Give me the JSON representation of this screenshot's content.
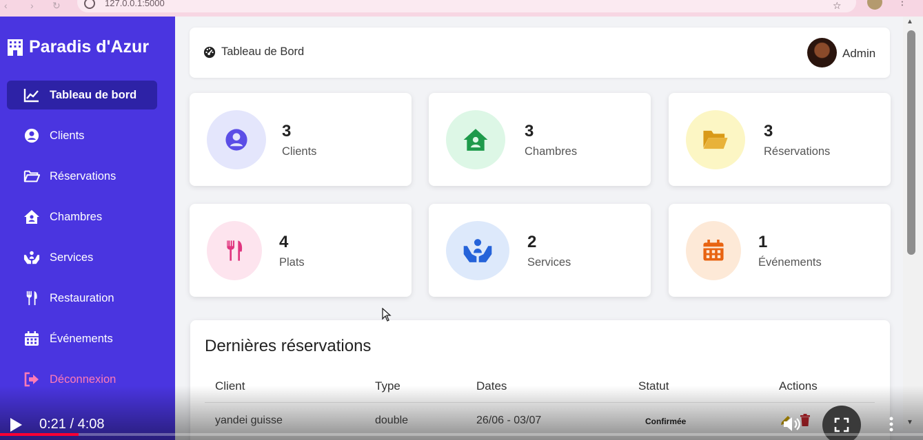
{
  "browser": {
    "url": "127.0.0.1:5000"
  },
  "sidebar": {
    "brand": "Paradis d'Azur",
    "items": [
      {
        "label": "Tableau de bord",
        "icon": "chart-line-icon",
        "active": true
      },
      {
        "label": "Clients",
        "icon": "user-circle-icon"
      },
      {
        "label": "Réservations",
        "icon": "folder-open-icon"
      },
      {
        "label": "Chambres",
        "icon": "house-user-icon"
      },
      {
        "label": "Services",
        "icon": "hands-helping-icon"
      },
      {
        "label": "Restauration",
        "icon": "utensils-icon"
      },
      {
        "label": "Événements",
        "icon": "calendar-icon"
      },
      {
        "label": "Déconnexion",
        "icon": "sign-out-icon"
      }
    ]
  },
  "header": {
    "title": "Tableau de Bord",
    "user": "Admin"
  },
  "stats": [
    {
      "value": "3",
      "label": "Clients",
      "icon": "user-circle-icon",
      "color": "#5b4ee6",
      "bg": "#e4e6fc"
    },
    {
      "value": "3",
      "label": "Chambres",
      "icon": "house-user-icon",
      "color": "#1e9a4b",
      "bg": "#ddf7e6"
    },
    {
      "value": "3",
      "label": "Réservations",
      "icon": "folder-open-icon",
      "color": "#d99a18",
      "bg": "#fcf6c4"
    },
    {
      "value": "4",
      "label": "Plats",
      "icon": "utensils-icon",
      "color": "#e0357f",
      "bg": "#fde4ee"
    },
    {
      "value": "2",
      "label": "Services",
      "icon": "hands-helping-icon",
      "color": "#2563d9",
      "bg": "#dde9fb"
    },
    {
      "value": "1",
      "label": "Événements",
      "icon": "calendar-icon",
      "color": "#e86412",
      "bg": "#fde9d7"
    }
  ],
  "reservations": {
    "title": "Dernières réservations",
    "columns": [
      "Client",
      "Type",
      "Dates",
      "Statut",
      "Actions"
    ],
    "rows": [
      {
        "client": "yandei guisse",
        "type": "double",
        "dates": "26/06 - 03/07",
        "status": "Confirmée"
      }
    ]
  },
  "video": {
    "time": "0:21 / 4:08",
    "progress": 0.085
  },
  "colors": {
    "sidebar": "#4a35e0",
    "sidebar_active": "#2d22a6",
    "logout": "#ff7bb6"
  }
}
